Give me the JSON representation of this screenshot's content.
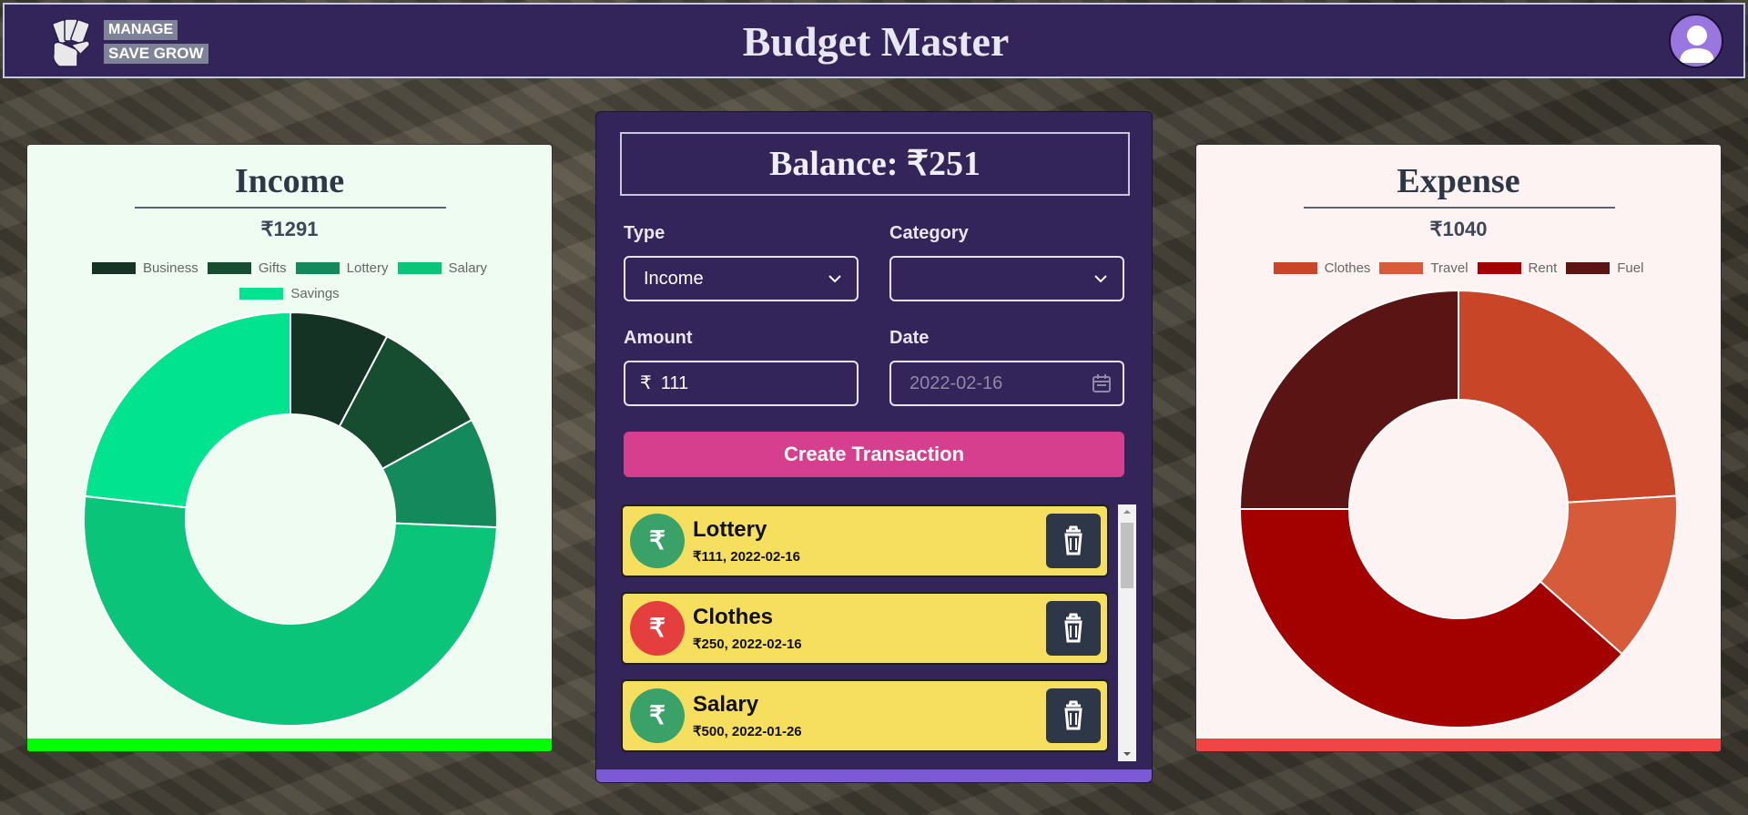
{
  "header": {
    "brand_tag_1": "MANAGE",
    "brand_tag_2": "SAVE GROW",
    "title": "Budget Master"
  },
  "income": {
    "title": "Income",
    "total": "₹1291",
    "legend": [
      {
        "label": "Business",
        "color": "#143324"
      },
      {
        "label": "Gifts",
        "color": "#164d30"
      },
      {
        "label": "Lottery",
        "color": "#148a5c"
      },
      {
        "label": "Salary",
        "color": "#0ac47a"
      },
      {
        "label": "Savings",
        "color": "#02e38f"
      }
    ]
  },
  "expense": {
    "title": "Expense",
    "total": "₹1040",
    "legend": [
      {
        "label": "Clothes",
        "color": "#c94528"
      },
      {
        "label": "Travel",
        "color": "#d55b3b"
      },
      {
        "label": "Rent",
        "color": "#a30000"
      },
      {
        "label": "Fuel",
        "color": "#5b1414"
      }
    ]
  },
  "chart_data": [
    {
      "type": "pie",
      "title": "Income",
      "categories": [
        "Business",
        "Gifts",
        "Lottery",
        "Salary",
        "Savings"
      ],
      "values": [
        100,
        120,
        111,
        660,
        300
      ],
      "colors": [
        "#143324",
        "#164d30",
        "#148a5c",
        "#0ac47a",
        "#02e38f"
      ],
      "donut": true,
      "legend": "top"
    },
    {
      "type": "pie",
      "title": "Expense",
      "categories": [
        "Clothes",
        "Travel",
        "Rent",
        "Fuel"
      ],
      "values": [
        250,
        130,
        400,
        260
      ],
      "colors": [
        "#c94528",
        "#d55b3b",
        "#a30000",
        "#5b1414"
      ],
      "donut": true,
      "legend": "top"
    }
  ],
  "form": {
    "balance": "Balance: ₹251",
    "type_label": "Type",
    "type_value": "Income",
    "category_label": "Category",
    "category_value": "",
    "amount_label": "Amount",
    "amount_prefix": "₹",
    "amount_value": "111",
    "date_label": "Date",
    "date_placeholder": "2022-02-16",
    "submit_label": "Create Transaction"
  },
  "transactions": [
    {
      "name": "Lottery",
      "meta": "₹111, 2022-02-16",
      "kind": "income",
      "icon": "rupee-icon",
      "color": "#3aa169"
    },
    {
      "name": "Clothes",
      "meta": "₹250, 2022-02-16",
      "kind": "expense",
      "icon": "rupee-icon",
      "color": "#e53e3e"
    },
    {
      "name": "Salary",
      "meta": "₹500, 2022-01-26",
      "kind": "income",
      "icon": "rupee-icon",
      "color": "#3aa169"
    }
  ]
}
